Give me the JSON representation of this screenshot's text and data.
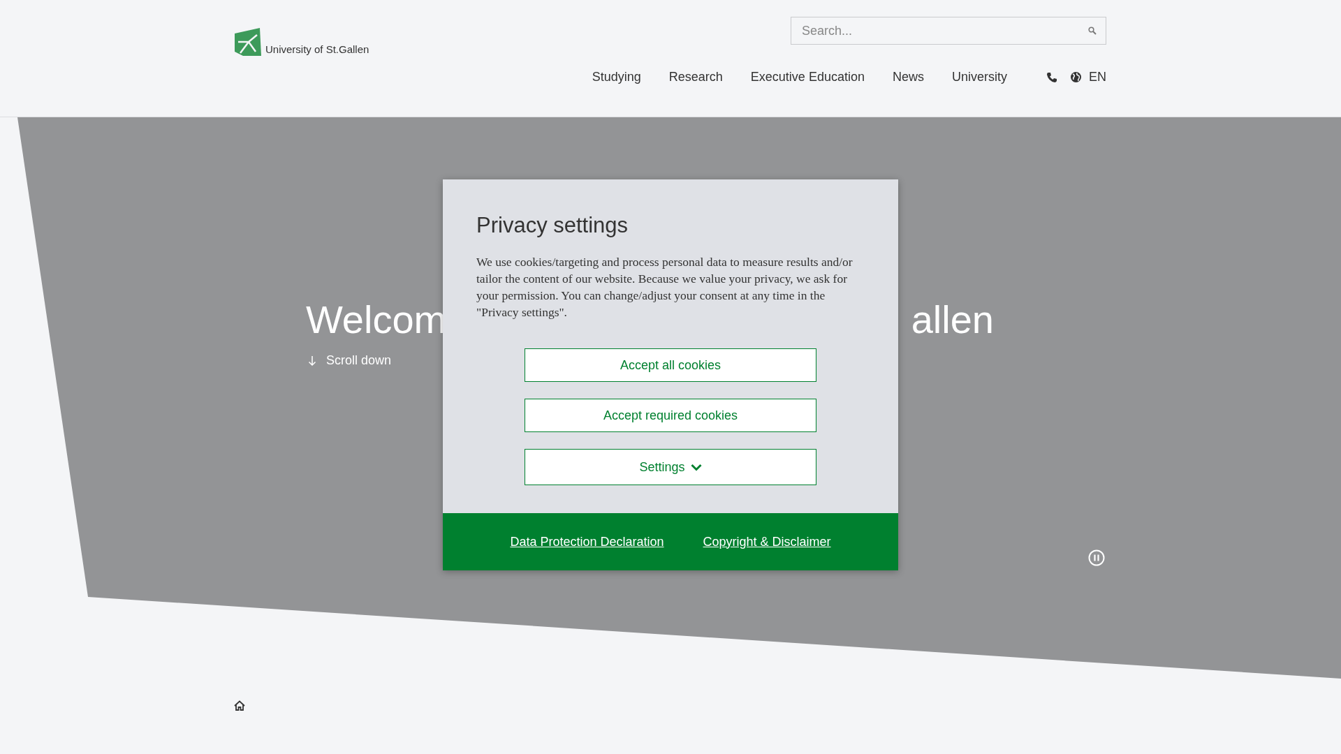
{
  "header": {
    "logo_text": "University of St.Gallen",
    "search": {
      "placeholder": "Search..."
    },
    "nav": [
      {
        "label": "Studying"
      },
      {
        "label": "Research"
      },
      {
        "label": "Executive Education"
      },
      {
        "label": "News"
      },
      {
        "label": "University"
      }
    ],
    "language": "EN"
  },
  "hero": {
    "title_left": "Welcom",
    "title_right": "allen",
    "scroll_label": "Scroll down"
  },
  "dialog": {
    "title": "Privacy settings",
    "text": "We use cookies/targeting and process personal data to measure results and/or tailor the content of our website. Because we value your privacy, we ask for your permission. You can change/adjust your consent at any time in the \"Privacy settings\".",
    "buttons": [
      {
        "label": "Accept all cookies",
        "kind": "plain"
      },
      {
        "label": "Accept required cookies",
        "kind": "plain"
      },
      {
        "label": "Settings",
        "kind": "dropdown"
      }
    ],
    "links": [
      "Data Protection Declaration",
      "Copyright & Disclaimer"
    ]
  }
}
